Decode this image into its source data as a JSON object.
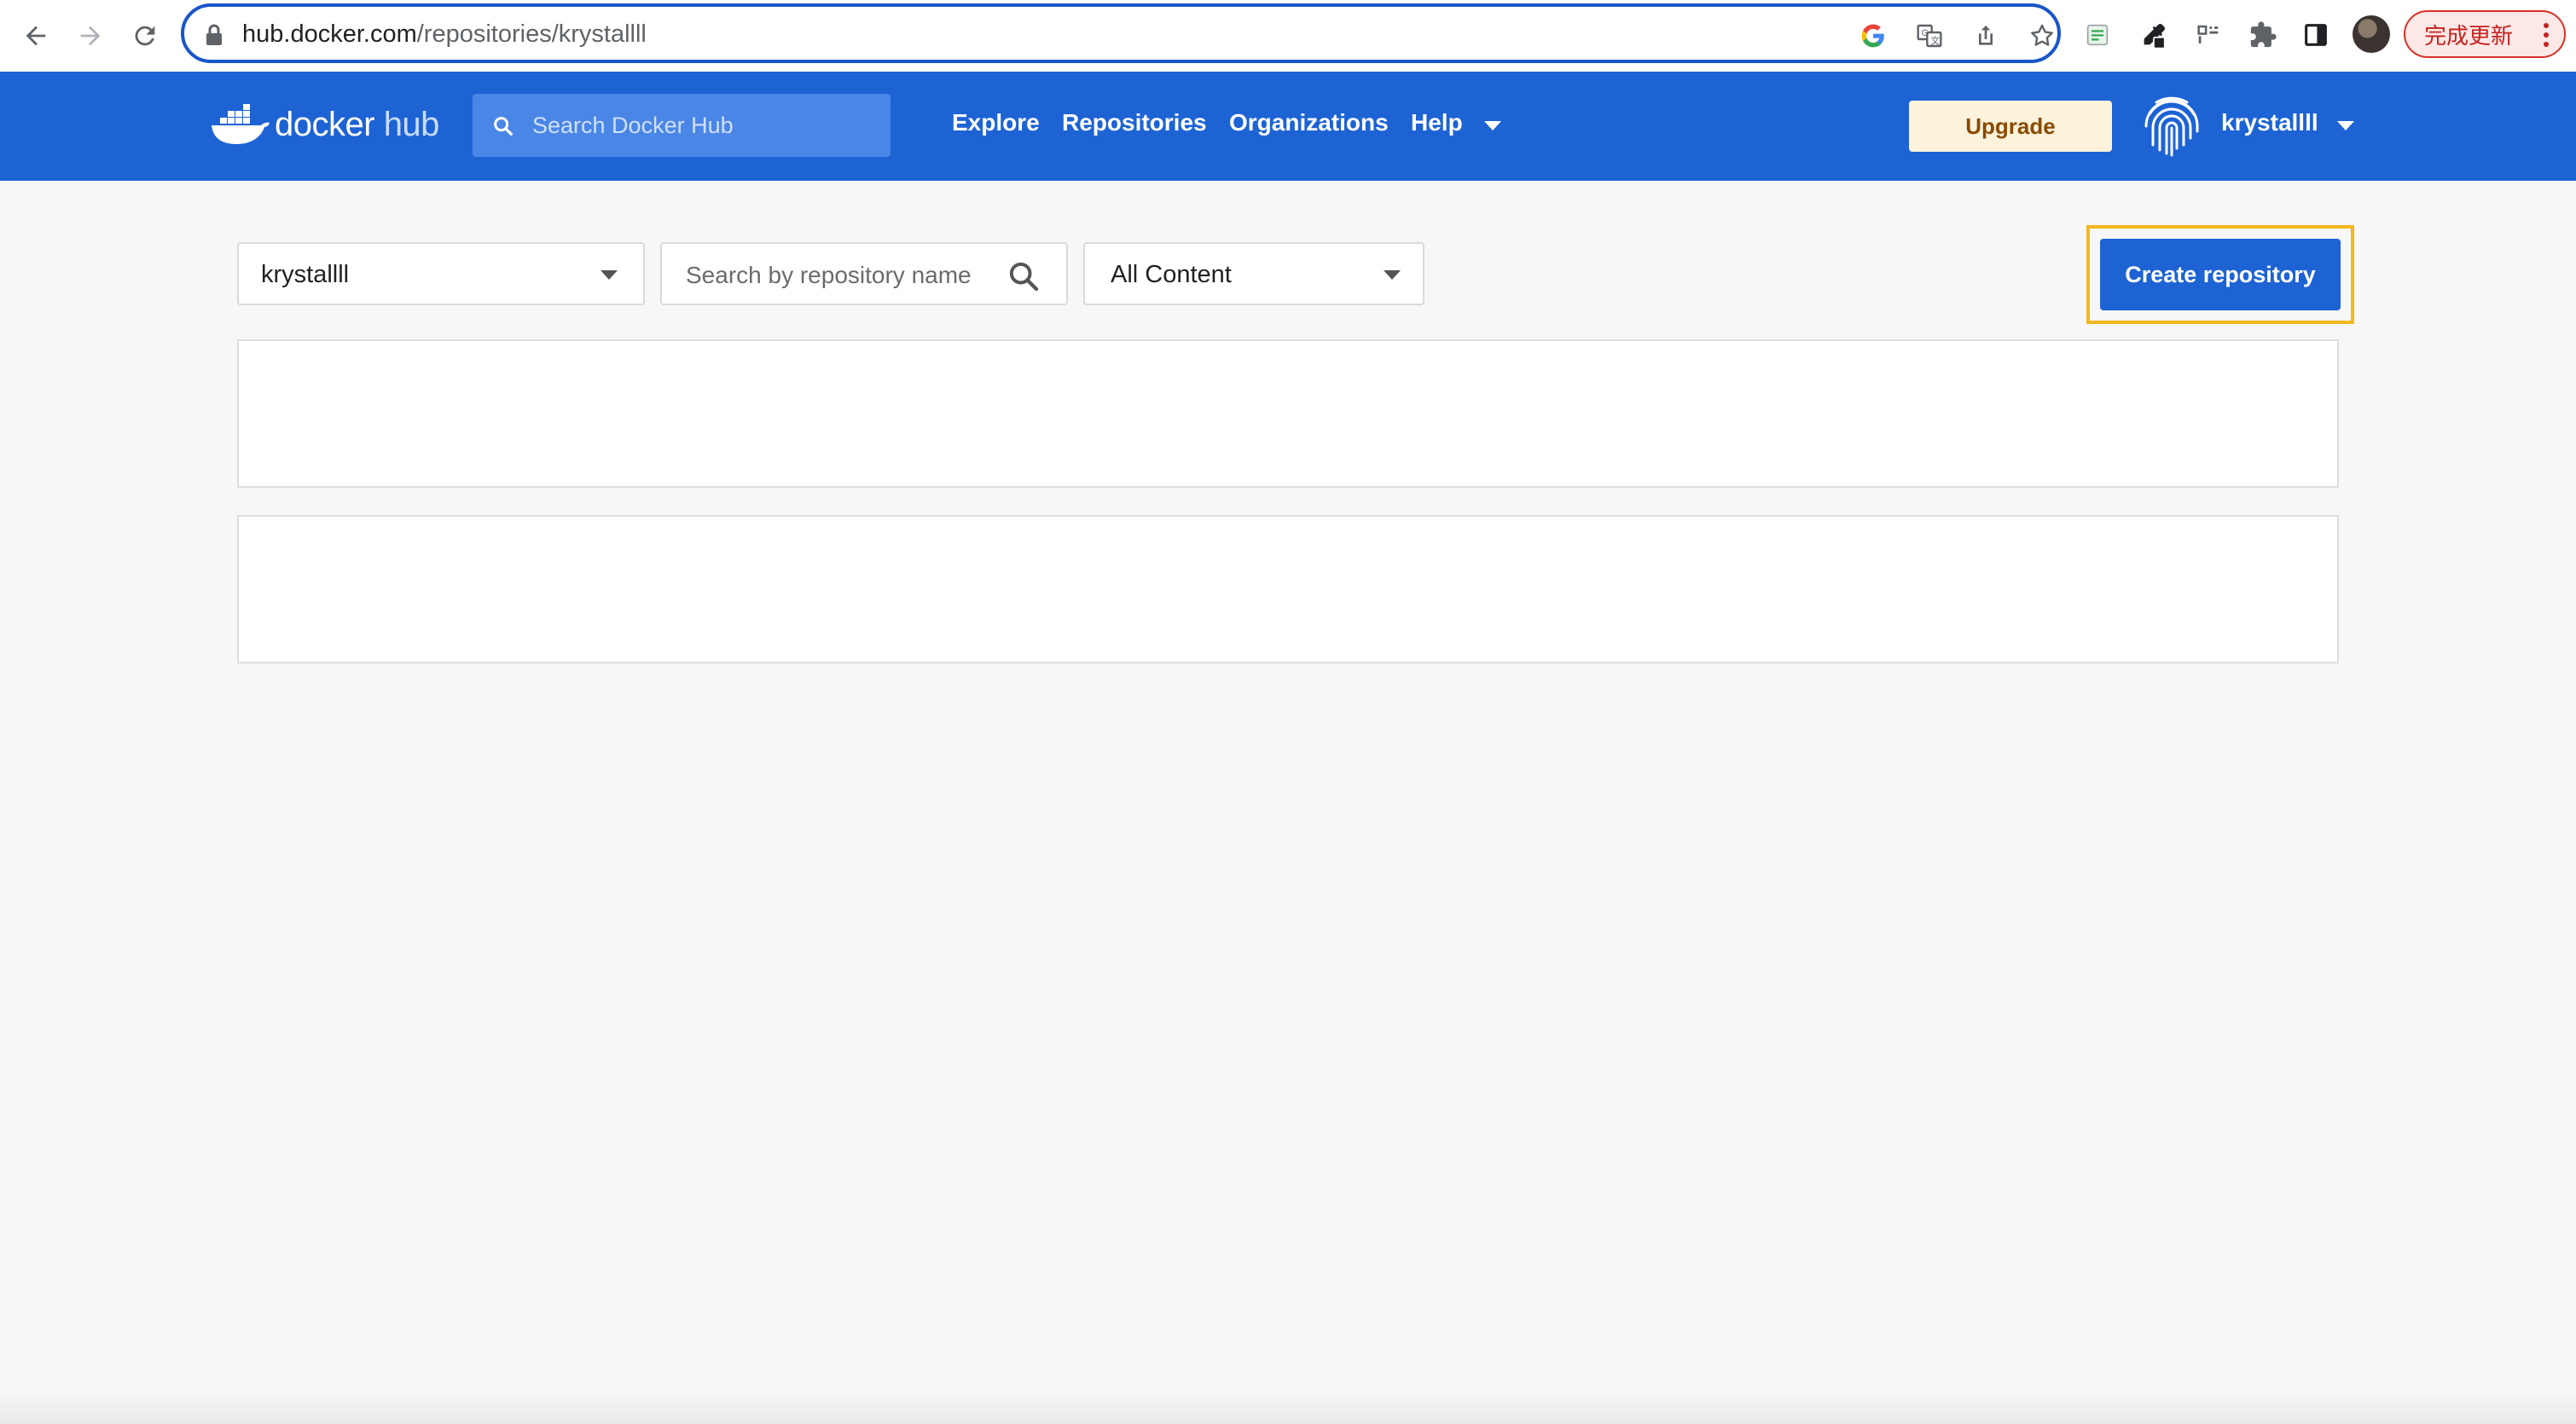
{
  "browser": {
    "url_host": "hub.docker.com",
    "url_path": "/repositories/krystallll",
    "update_label": "完成更新",
    "icons": [
      "back-arrow-icon",
      "forward-arrow-icon",
      "reload-icon",
      "lock-icon",
      "google-icon",
      "translate-icon",
      "share-icon",
      "bookmark-star-icon",
      "sheets-extension-icon",
      "eyedropper-extension-icon",
      "qr-extension-icon",
      "puzzle-extensions-icon",
      "sidepanel-icon",
      "kebab-menu-icon"
    ]
  },
  "header": {
    "logo_docker": "docker",
    "logo_hub": "hub",
    "search_placeholder": "Search Docker Hub",
    "nav": [
      "Explore",
      "Repositories",
      "Organizations",
      "Help"
    ],
    "upgrade_label": "Upgrade",
    "username": "krystallll",
    "brand_color": "#1d63d4"
  },
  "toolbar": {
    "namespace": "krystallll",
    "repo_search_placeholder": "Search by repository name",
    "content_filter": "All Content",
    "create_label": "Create repository",
    "highlight_color": "#f3b820"
  },
  "cards": [
    {
      "id": "card-1"
    },
    {
      "id": "card-2"
    }
  ]
}
